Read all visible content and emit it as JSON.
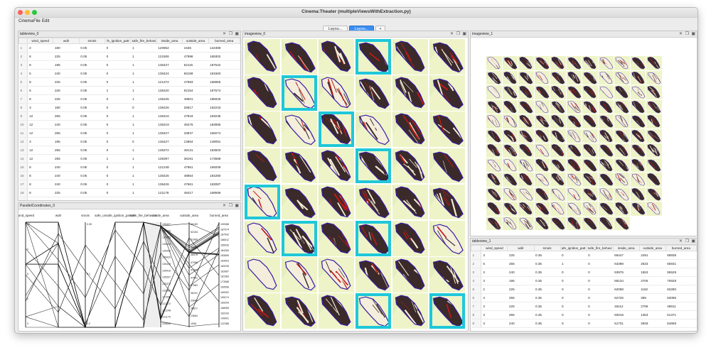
{
  "window": {
    "title": "Cinema:Theater (multipleViewsWithExtraction.py)",
    "menu": [
      "Cinema",
      "File",
      "Edit"
    ],
    "tabs": [
      {
        "label": "Layou...",
        "active": false
      },
      {
        "label": "Layou...",
        "active": true
      },
      {
        "label": "+",
        "active": false
      }
    ]
  },
  "panels": {
    "tableview_0": {
      "title": "tableview_0"
    },
    "parallel": {
      "title": "ParallelCoordinates_0"
    },
    "imageview_0": {
      "title": "imageview_0"
    },
    "imageview_1": {
      "title": "imageview_1"
    },
    "tableview_1": {
      "title": "tableview_1"
    }
  },
  "panel_buttons": {
    "close": "✕",
    "float": "❐",
    "max": "▣"
  },
  "table0": {
    "columns": [
      "",
      "wind_speed",
      "wdir",
      "smois",
      "fuels_ignition_pattern",
      "safe_fire_behavior",
      "inside_area",
      "outside_area",
      "burned_area"
    ],
    "columns_display": [
      "",
      "wind_speed",
      "wdir",
      "smois",
      "fe_ignition_patt",
      "safe_fire_behavi",
      "inside_area",
      "outside_area",
      "burned_area"
    ],
    "rows": [
      [
        "1",
        "2",
        "180",
        "0.05",
        "0",
        "1",
        "120852",
        "1536",
        "122388"
      ],
      [
        "2",
        "8",
        "225",
        "0.05",
        "0",
        "1",
        "121506",
        "47996",
        "169302"
      ],
      [
        "3",
        "8",
        "195",
        "0.05",
        "0",
        "1",
        "135427",
        "52115",
        "187542"
      ],
      [
        "4",
        "5",
        "240",
        "0.05",
        "0",
        "1",
        "135424",
        "66159",
        "181583"
      ],
      [
        "5",
        "8",
        "225",
        "0.05",
        "0",
        "1",
        "121372",
        "47583",
        "168955"
      ],
      [
        "6",
        "8",
        "225",
        "0.05",
        "1",
        "1",
        "135420",
        "52154",
        "187574"
      ],
      [
        "7",
        "8",
        "225",
        "0.05",
        "0",
        "1",
        "135425",
        "49601",
        "185026"
      ],
      [
        "8",
        "3",
        "180",
        "0.05",
        "0",
        "0",
        "135426",
        "26817",
        "162243"
      ],
      [
        "9",
        "12",
        "255",
        "0.05",
        "0",
        "1",
        "135416",
        "47819",
        "183235"
      ],
      [
        "10",
        "12",
        "240",
        "0.05",
        "0",
        "1",
        "135419",
        "48476",
        "183895"
      ],
      [
        "11",
        "12",
        "255",
        "0.05",
        "0",
        "1",
        "135427",
        "33847",
        "169274"
      ],
      [
        "12",
        "3",
        "195",
        "0.05",
        "0",
        "0",
        "135427",
        "13664",
        "149091"
      ],
      [
        "13",
        "12",
        "255",
        "0.05",
        "0",
        "1",
        "135372",
        "48131",
        "183503"
      ],
      [
        "14",
        "12",
        "255",
        "0.05",
        "1",
        "1",
        "135397",
        "38191",
        "173588"
      ],
      [
        "15",
        "8",
        "240",
        "0.05",
        "0",
        "1",
        "121248",
        "47961",
        "169209"
      ],
      [
        "16",
        "8",
        "240",
        "0.05",
        "0",
        "1",
        "135426",
        "48854",
        "184280"
      ],
      [
        "17",
        "8",
        "240",
        "0.05",
        "0",
        "1",
        "135426",
        "47661",
        "183087"
      ],
      [
        "18",
        "8",
        "225",
        "0.05",
        "0",
        "1",
        "121179",
        "48417",
        "169596"
      ],
      [
        "19",
        "12",
        "180",
        "0.05",
        "1",
        "1",
        "135423",
        "51089",
        "186512"
      ]
    ]
  },
  "table1": {
    "columns": [
      "",
      "wind_speed",
      "wdir",
      "smois",
      "fuels_ignition_pattern",
      "safe_fire_behavior",
      "inside_area",
      "outside_area",
      "burned_area"
    ],
    "columns_display": [
      "",
      "wind_speed",
      "wdir",
      "smois",
      "afe_ignition_patt",
      "safe_fire_behavi",
      "inside_area",
      "outside_area",
      "burned_area"
    ],
    "rows": [
      [
        "1",
        "3",
        "225",
        "0.35",
        "0",
        "0",
        "66447",
        "2491",
        "68938"
      ],
      [
        "2",
        "5",
        "255",
        "0.35",
        "1",
        "0",
        "63398",
        "2533",
        "65931"
      ],
      [
        "3",
        "3",
        "240",
        "0.35",
        "0",
        "0",
        "53976",
        "1553",
        "55529"
      ],
      [
        "4",
        "3",
        "195",
        "0.35",
        "0",
        "0",
        "68134",
        "2705",
        "70829"
      ],
      [
        "5",
        "2",
        "225",
        "0.35",
        "0",
        "0",
        "62098",
        "1182",
        "63280"
      ],
      [
        "6",
        "3",
        "255",
        "0.35",
        "0",
        "0",
        "62726",
        "369",
        "63095"
      ],
      [
        "7",
        "3",
        "225",
        "0.35",
        "0",
        "0",
        "46112",
        "2799",
        "48911"
      ],
      [
        "8",
        "3",
        "255",
        "0.35",
        "0",
        "0",
        "60018",
        "1353",
        "61371"
      ],
      [
        "9",
        "3",
        "240",
        "0.35",
        "0",
        "0",
        "51731",
        "2928",
        "54659"
      ]
    ]
  },
  "parallel": {
    "axes": [
      "wind_speed",
      "wdir",
      "smois",
      "safe_unsafe_ignition_pattern",
      "safe_fire_behavior",
      "inside_area",
      "outside_area",
      "burned_area"
    ],
    "axes_display": [
      "wind_speed",
      "wdir",
      "smois",
      "safe_unsafe_ignition_pattern",
      "safe_fire_behavior",
      "inside_area",
      "outside_area",
      "burned_area"
    ],
    "ticks": {
      "wind_speed": [
        "12",
        "1",
        "5",
        "2",
        "3"
      ],
      "smois": [
        "0.05",
        "0.1",
        "0.2"
      ],
      "inside_area": [
        "135427",
        "135426",
        "135425",
        "135424",
        "135423",
        "135420",
        "135419",
        "135416",
        "135397",
        "135372",
        "122850",
        "121506",
        "121372",
        "121248",
        "121179",
        "120852"
      ],
      "outside_area": [
        "66159",
        "52154",
        "51089",
        "48854",
        "48476",
        "47996",
        "47819",
        "47661",
        "47583",
        "38191",
        "33847",
        "26817",
        "13664",
        "1536"
      ],
      "burned_area": [
        "190088",
        "187574",
        "187542",
        "186512",
        "185026",
        "184280",
        "183895",
        "183503",
        "183235",
        "183087",
        "181583",
        "173588",
        "169596",
        "169302",
        "169274",
        "169209",
        "168955",
        "162243",
        "149091",
        "122388"
      ]
    }
  },
  "colors": {
    "highlight": "#1ec8d8",
    "thumb_bg": "#eef4c8",
    "burn_dark": "#3a2a2a",
    "outline": "#3a1aa8",
    "fire_red": "#c0181a",
    "tab_active": "#3b8df2"
  }
}
